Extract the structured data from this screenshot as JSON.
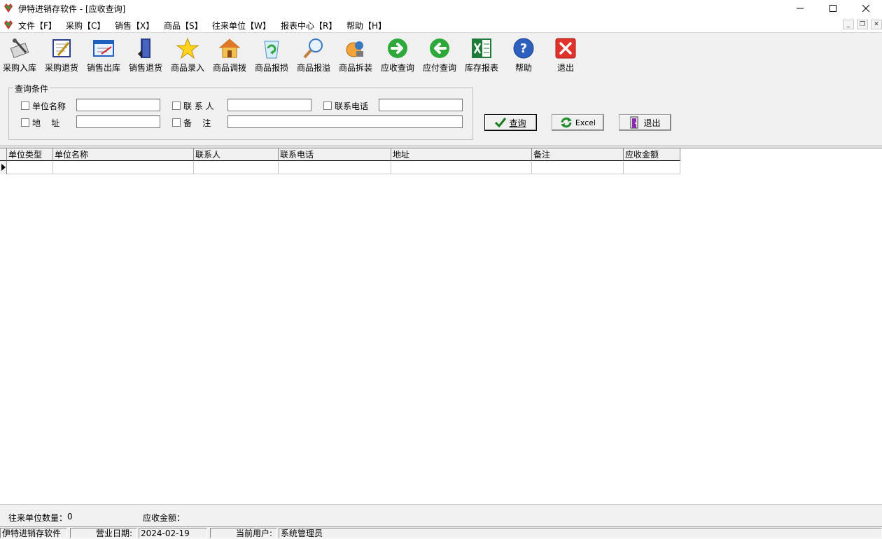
{
  "window": {
    "title": "伊特进销存软件 - [应收查询]"
  },
  "menu": {
    "items": [
      "文件【F】",
      "采购【C】",
      "销售【X】",
      "商品【S】",
      "往来单位【W】",
      "报表中心【R】",
      "帮助【H】"
    ]
  },
  "toolbar": {
    "items": [
      {
        "label": "采购入库",
        "icon": "purchase-in-icon"
      },
      {
        "label": "采购退货",
        "icon": "purchase-return-icon"
      },
      {
        "label": "销售出库",
        "icon": "sales-out-icon"
      },
      {
        "label": "销售退货",
        "icon": "sales-return-icon"
      },
      {
        "label": "商品录入",
        "icon": "star-icon"
      },
      {
        "label": "商品调拨",
        "icon": "house-icon"
      },
      {
        "label": "商品报损",
        "icon": "recycle-bin-icon"
      },
      {
        "label": "商品报溢",
        "icon": "magnifier-icon"
      },
      {
        "label": "商品拆装",
        "icon": "parts-icon"
      },
      {
        "label": "应收查询",
        "icon": "arrow-right-icon"
      },
      {
        "label": "应付查询",
        "icon": "arrow-left-icon"
      },
      {
        "label": "库存报表",
        "icon": "excel-icon"
      },
      {
        "label": "帮助",
        "icon": "help-icon"
      },
      {
        "label": "退出",
        "icon": "close-icon"
      }
    ]
  },
  "query": {
    "legend": "查询条件",
    "unit_name_label": "单位名称",
    "contact_label": "联 系 人",
    "phone_label": "联系电话",
    "address_label": "地    址",
    "remark_label": "备    注",
    "unit_name_value": "",
    "contact_value": "",
    "phone_value": "",
    "address_value": "",
    "remark_value": ""
  },
  "buttons": {
    "query": "查询",
    "excel": "Excel",
    "exit": "退出"
  },
  "grid": {
    "columns": [
      "单位类型",
      "单位名称",
      "联系人",
      "联系电话",
      "地址",
      "备注",
      "应收金额"
    ]
  },
  "footer": {
    "count_label": "往来单位数量：",
    "count_value": "0",
    "amount_label": "应收金额："
  },
  "status": {
    "app_name": "伊特进销存软件",
    "date_label": "营业日期:",
    "date_value": "2024-02-19",
    "user_label": "当前用户:",
    "user_value": "系统管理员"
  },
  "colors": {
    "accent_green": "#2ea83a",
    "accent_red": "#d9262c",
    "accent_blue": "#1f5fbf"
  }
}
